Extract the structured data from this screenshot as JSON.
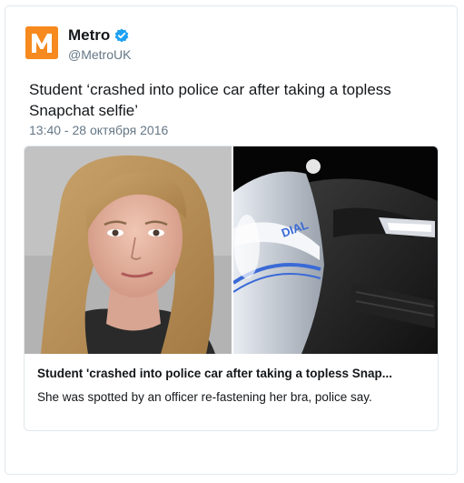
{
  "author": {
    "name": "Metro",
    "handle": "@MetroUK",
    "logo_letter": "M",
    "logo_color": "#f68a1f",
    "verified_color": "#1da1f2"
  },
  "tweet": {
    "text": "Student ‘crashed into police car after taking a topless Snapchat selfie’",
    "timestamp": "13:40 - 28 октября 2016"
  },
  "card": {
    "title": "Student 'crashed into police car after taking a topless Snap...",
    "description": "She was spotted by an officer re-fastening her bra, police say.",
    "left_image": "mugshot-photo",
    "right_image": "crashed-police-car-photo",
    "police_car_text": "DIAL"
  }
}
